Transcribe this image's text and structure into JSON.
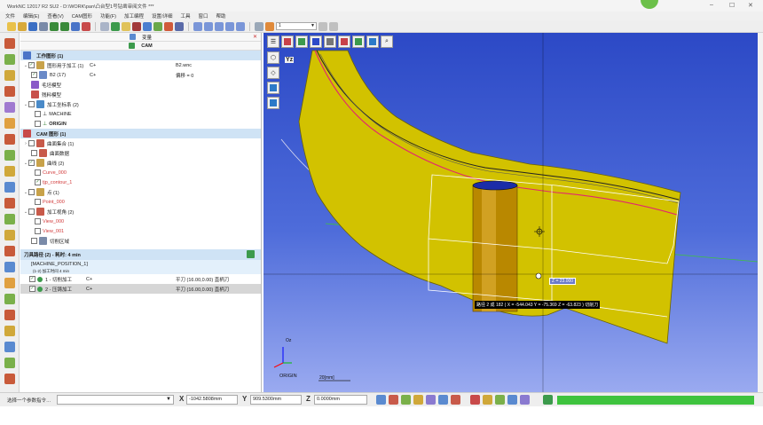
{
  "window": {
    "title": "WorkNC 12017 R2 SU2 - D:\\WORK\\pan\\凸台型1号钻凿审阅文件 ***",
    "controls": [
      "–",
      "☐",
      "✕"
    ]
  },
  "menu": [
    "文件",
    "编辑(E)",
    "查看(V)",
    "CAM图形",
    "功能(F)",
    "加工编程",
    "设置/详细",
    "工具",
    "窗口",
    "帮助"
  ],
  "toolbar": {
    "view_combo_value": "1"
  },
  "panel": {
    "tab_main": "变量",
    "tab_cam": "CAM",
    "workzone": {
      "header": "工作图形 (1)",
      "rows": [
        {
          "label": "图形用于加工 (1)",
          "col_b": "C+",
          "col_c": "B2.wnc"
        },
        {
          "label": "B2 (17)",
          "col_b": "C+",
          "col_c": "偏移 = 0"
        },
        {
          "label": "毛坯模型"
        },
        {
          "label": "残料模型"
        },
        {
          "label": "加工坐标系 (2)"
        },
        {
          "label": "MACHINE"
        },
        {
          "label": "ORIGIN"
        }
      ]
    },
    "cam_graph": {
      "header": "CAM 图形 (1)",
      "rows": [
        {
          "label": "曲面集合 (1)"
        },
        {
          "label": "曲面数据"
        },
        {
          "label": "曲线 (2)"
        },
        {
          "label": "Curve_000"
        },
        {
          "label": "tjp_contour_1"
        },
        {
          "label": "点 (1)"
        },
        {
          "label": "Point_000"
        },
        {
          "label": "加工视角 (2)"
        },
        {
          "label": "View_000"
        },
        {
          "label": "View_001"
        },
        {
          "label": "切削区域"
        }
      ]
    },
    "toolpaths": {
      "header": "刀具路径 (2) - 耗时: 4 min",
      "machine_row": "[MACHINE_POSITION_1]",
      "machine_sub": "(1-2) 加工时间 4 min",
      "rows": [
        {
          "label": "1 - 切削加工",
          "col_b": "C+",
          "col_c": "平刀 (16.00,0.00) 直柄刀"
        },
        {
          "label": "2 - 压铸加工",
          "col_b": "C+",
          "col_c": "平刀 (16.00,0.00) 直柄刀"
        }
      ]
    }
  },
  "viewport": {
    "axis_label_top": "Yz",
    "tooltip": "路径 2 成 182 ( X = -544.043  Y = -75.369  Z = -63.823 ) 切削刀",
    "cursor_label": "Z = 23.000",
    "axis_z": "Oz",
    "origin_label": "ORIGIN",
    "scale_label": "20[mm]",
    "colors": {
      "part_fill": "#d2c200",
      "background": "#2c49c6",
      "toolpath_line": "#e2276e"
    }
  },
  "statusbar": {
    "hint": "选择一个参数指令…",
    "x_label": "X",
    "x_value": "-1042.5808mm",
    "y_label": "Y",
    "y_value": "909.5300mm",
    "z_label": "Z",
    "z_value": "0.0000mm",
    "progress": 1.0
  }
}
